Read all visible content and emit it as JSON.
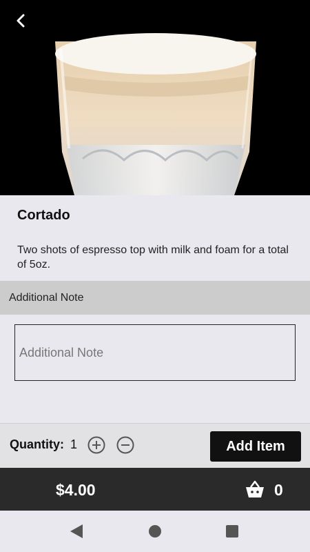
{
  "product": {
    "image": "cortado-glass-photo",
    "name": "Cortado",
    "description": "Two shots of espresso top with milk and foam for a total of 5oz."
  },
  "note": {
    "section_label": "Additional Note",
    "placeholder": "Additional Note",
    "value": ""
  },
  "quantity": {
    "label": "Quantity:",
    "value": "1"
  },
  "actions": {
    "add_item_label": "Add Item"
  },
  "cart": {
    "total": "$4.00",
    "count": "0"
  },
  "icons": {
    "back": "chevron-left-icon",
    "plus": "plus-circle-icon",
    "minus": "minus-circle-icon",
    "basket": "basket-icon",
    "nav_back": "nav-back-triangle-icon",
    "nav_home": "nav-home-circle-icon",
    "nav_recent": "nav-recent-square-icon"
  },
  "colors": {
    "accent": "#111111",
    "cart_bar": "#2a2a2a",
    "page_background": "#e9e8ee",
    "section_header": "#cccccc"
  }
}
